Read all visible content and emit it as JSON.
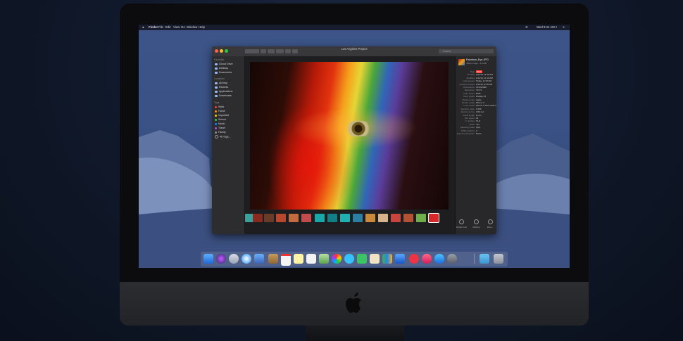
{
  "menubar": {
    "apple": "",
    "items": [
      "Finder",
      "File",
      "Edit",
      "View",
      "Go",
      "Window",
      "Help"
    ],
    "clock": "Wed 9:41 AM"
  },
  "window": {
    "title": "Los Angeles Project",
    "search_placeholder": "Search"
  },
  "sidebar": {
    "sections": [
      "Favorites",
      "Locations",
      "Tags"
    ],
    "favorites": [
      "iCloud Drive",
      "Desktop",
      "Documents",
      "AirDrop",
      "Recents",
      "Applications",
      "Downloads"
    ],
    "tags": [
      {
        "label": "Work",
        "color": "#ff3b30"
      },
      {
        "label": "Home",
        "color": "#ff9500"
      },
      {
        "label": "Important",
        "color": "#ffcc00"
      },
      {
        "label": "School",
        "color": "#34c759"
      },
      {
        "label": "Music",
        "color": "#0a84ff"
      },
      {
        "label": "Travel",
        "color": "#af52de"
      },
      {
        "label": "Family",
        "color": "#8e8e93"
      },
      {
        "label": "All Tags...",
        "color": ""
      }
    ]
  },
  "preview": {
    "filename": "Rainbow_Eye.JPG",
    "filetype": "JPEG image - 2.8 MB",
    "rows": [
      {
        "label": "Tags",
        "value": "Work"
      },
      {
        "label": "Created",
        "value": "2/11/19, 11:18 AM"
      },
      {
        "label": "Modified",
        "value": "2/11/19, 11:18 AM"
      },
      {
        "label": "Last opened",
        "value": "Today, 11:18 AM"
      },
      {
        "label": "Content created",
        "value": "2/11/19 11:18 AM"
      },
      {
        "label": "Dimensions",
        "value": "3072x2048"
      },
      {
        "label": "Resolution",
        "value": "72x72"
      },
      {
        "label": "Color space",
        "value": "RGB"
      },
      {
        "label": "Color profile",
        "value": "Display P3"
      },
      {
        "label": "Device make",
        "value": "Apple"
      },
      {
        "label": "Device model",
        "value": "iPhone X"
      },
      {
        "label": "Lens model",
        "value": "iPhone X back dual camera 6mm f/2.4"
      },
      {
        "label": "Aperture value",
        "value": "1.696"
      },
      {
        "label": "Exposure time",
        "value": "1/60 sec"
      },
      {
        "label": "Focal length",
        "value": "6 mm"
      },
      {
        "label": "ISO speed",
        "value": "64"
      },
      {
        "label": "F number",
        "value": "f/1.8"
      },
      {
        "label": "Flash",
        "value": "Yes"
      },
      {
        "label": "Metering mode",
        "value": "Spot"
      },
      {
        "label": "White balance",
        "value": "0"
      },
      {
        "label": "Exposure Program",
        "value": "Photo"
      }
    ],
    "actions": [
      "Rotate Left",
      "Markup",
      "More..."
    ]
  },
  "colors": {
    "accent": "#0a84ff",
    "window_bg": "#242426"
  }
}
